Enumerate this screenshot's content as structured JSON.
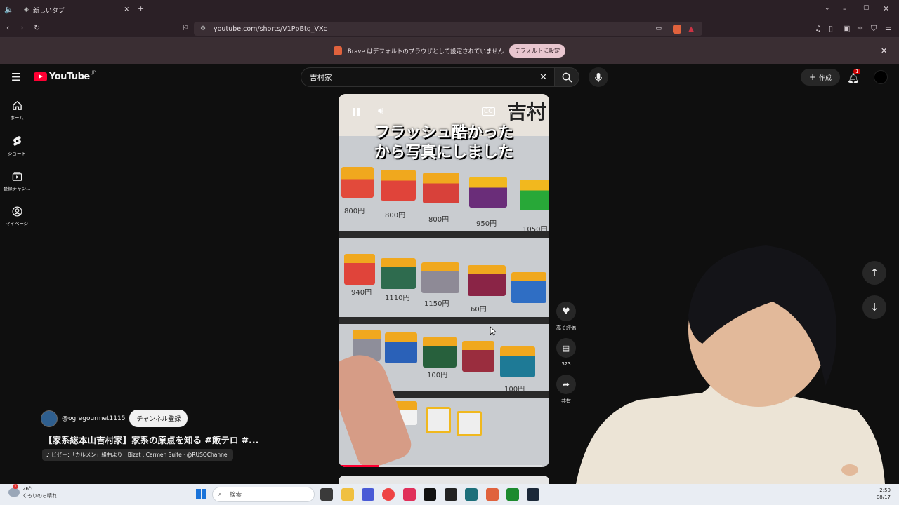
{
  "browser": {
    "tab_title": "新しいタブ",
    "url": "youtube.com/shorts/V1PpBtg_VXc",
    "infobar_text": "Brave はデフォルトのブラウザとして設定されていません",
    "infobar_button": "デフォルトに設定"
  },
  "youtube": {
    "logo_text": "YouTube",
    "logo_region": "JP",
    "search_value": "吉村家",
    "create_label": "作成",
    "notification_count": "1",
    "sidebar": [
      {
        "label": "ホーム",
        "icon": "home-icon"
      },
      {
        "label": "ショート",
        "icon": "shorts-icon"
      },
      {
        "label": "登録チャン...",
        "icon": "subscriptions-icon"
      },
      {
        "label": "マイページ",
        "icon": "profile-icon"
      }
    ]
  },
  "video": {
    "overlay_text_line1": "フラッシュ酷かった",
    "overlay_text_line2": "から写真にしました",
    "corner_sign": "吉村",
    "prices": [
      "800円",
      "800円",
      "800円",
      "950円",
      "1050円",
      "940円",
      "1110円",
      "1150円",
      "60円",
      "100円",
      "100円"
    ],
    "progress_pct": 20
  },
  "actions": {
    "like_label": "高く評価",
    "comment_count": "323",
    "share_label": "共有"
  },
  "channel": {
    "handle": "@ogregourmet1115",
    "subscribe_label": "チャンネル登録",
    "video_title": "【家系総本山吉村家】家系の原点を知る #飯テロ #...",
    "music": "♪ ビゼー：「カルメン」組曲より　Bizet : Carmen Suite · @RUSOChannel"
  },
  "taskbar": {
    "weather_temp": "26°C",
    "weather_desc": "くもりのち晴れ",
    "search_placeholder": "検索",
    "time": "2:50",
    "date": "08/17",
    "weather_badge": "1"
  }
}
